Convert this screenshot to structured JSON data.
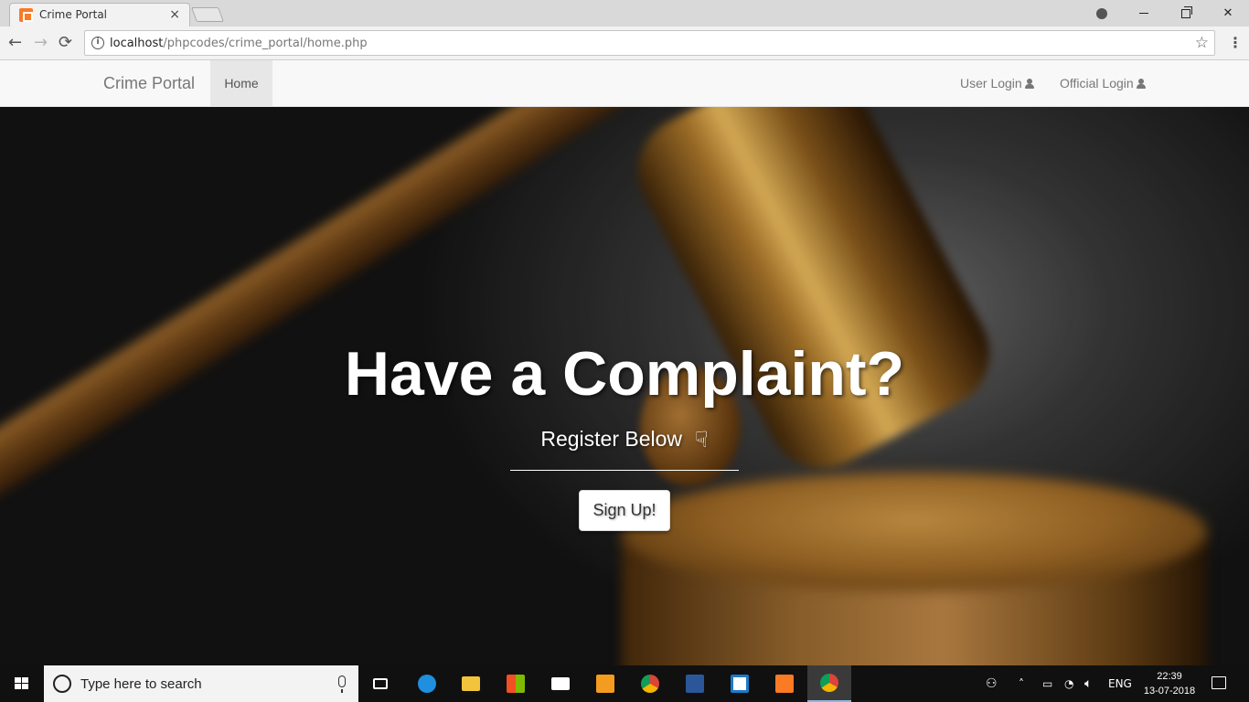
{
  "browser": {
    "tab_title": "Crime Portal",
    "tab_close": "×",
    "url_host": "localhost",
    "url_path": "/phpcodes/crime_portal/home.php",
    "back": "←",
    "forward": "→",
    "reload": "⟳",
    "star": "☆",
    "menu": "⋮",
    "close": "✕"
  },
  "navbar": {
    "brand": "Crime Portal",
    "home": "Home",
    "user_login": "User Login",
    "official_login": "Official Login"
  },
  "hero": {
    "title": "Have a Complaint?",
    "subtitle": "Register Below",
    "hand_glyph": "☟",
    "signup": "Sign Up!"
  },
  "taskbar": {
    "search_placeholder": "Type here to search",
    "language": "ENG",
    "time": "22:39",
    "date": "13-07-2018",
    "apps": [
      "task-view",
      "edge",
      "file-explorer",
      "store",
      "mail",
      "sublime-text",
      "chrome",
      "word",
      "brackets",
      "xampp",
      "chrome"
    ]
  },
  "colors": {
    "brand_text": "#777777",
    "navbar_bg": "#f8f8f8",
    "xampp_orange": "#fb7a24",
    "taskbar_bg": "#101010"
  }
}
